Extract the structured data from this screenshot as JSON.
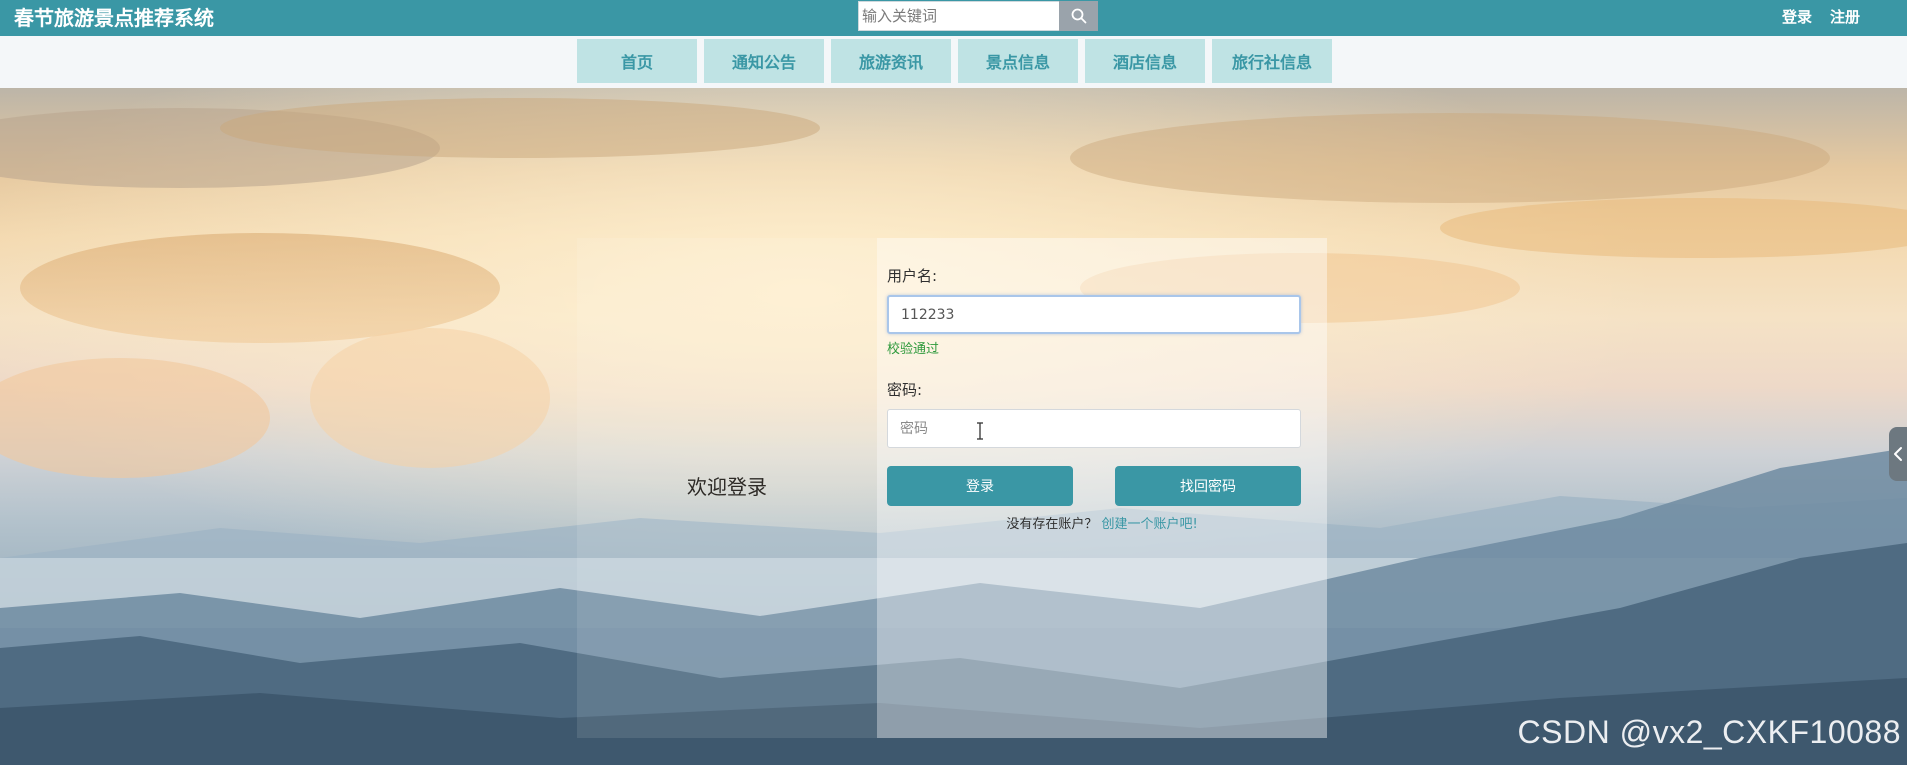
{
  "header": {
    "title": "春节旅游景点推荐系统",
    "search_placeholder": "输入关键词",
    "search_icon": "search-icon",
    "links": {
      "login": "登录",
      "register": "注册"
    }
  },
  "nav": {
    "items": [
      {
        "label": "首页"
      },
      {
        "label": "通知公告"
      },
      {
        "label": "旅游资讯"
      },
      {
        "label": "景点信息"
      },
      {
        "label": "酒店信息"
      },
      {
        "label": "旅行社信息"
      }
    ]
  },
  "login": {
    "welcome": "欢迎登录",
    "username_label": "用户名:",
    "username_value": "112233",
    "username_valid": "校验通过",
    "password_label": "密码:",
    "password_placeholder": "密码",
    "login_button": "登录",
    "recover_button": "找回密码",
    "no_account": "没有存在账户？",
    "create_account": "创建一个账户吧!"
  },
  "watermark": "CSDN @vx2_CXKF10088",
  "colors": {
    "primary": "#3a97a5",
    "nav_tab": "#bfe3e4",
    "valid_green": "#2e9a3c"
  }
}
